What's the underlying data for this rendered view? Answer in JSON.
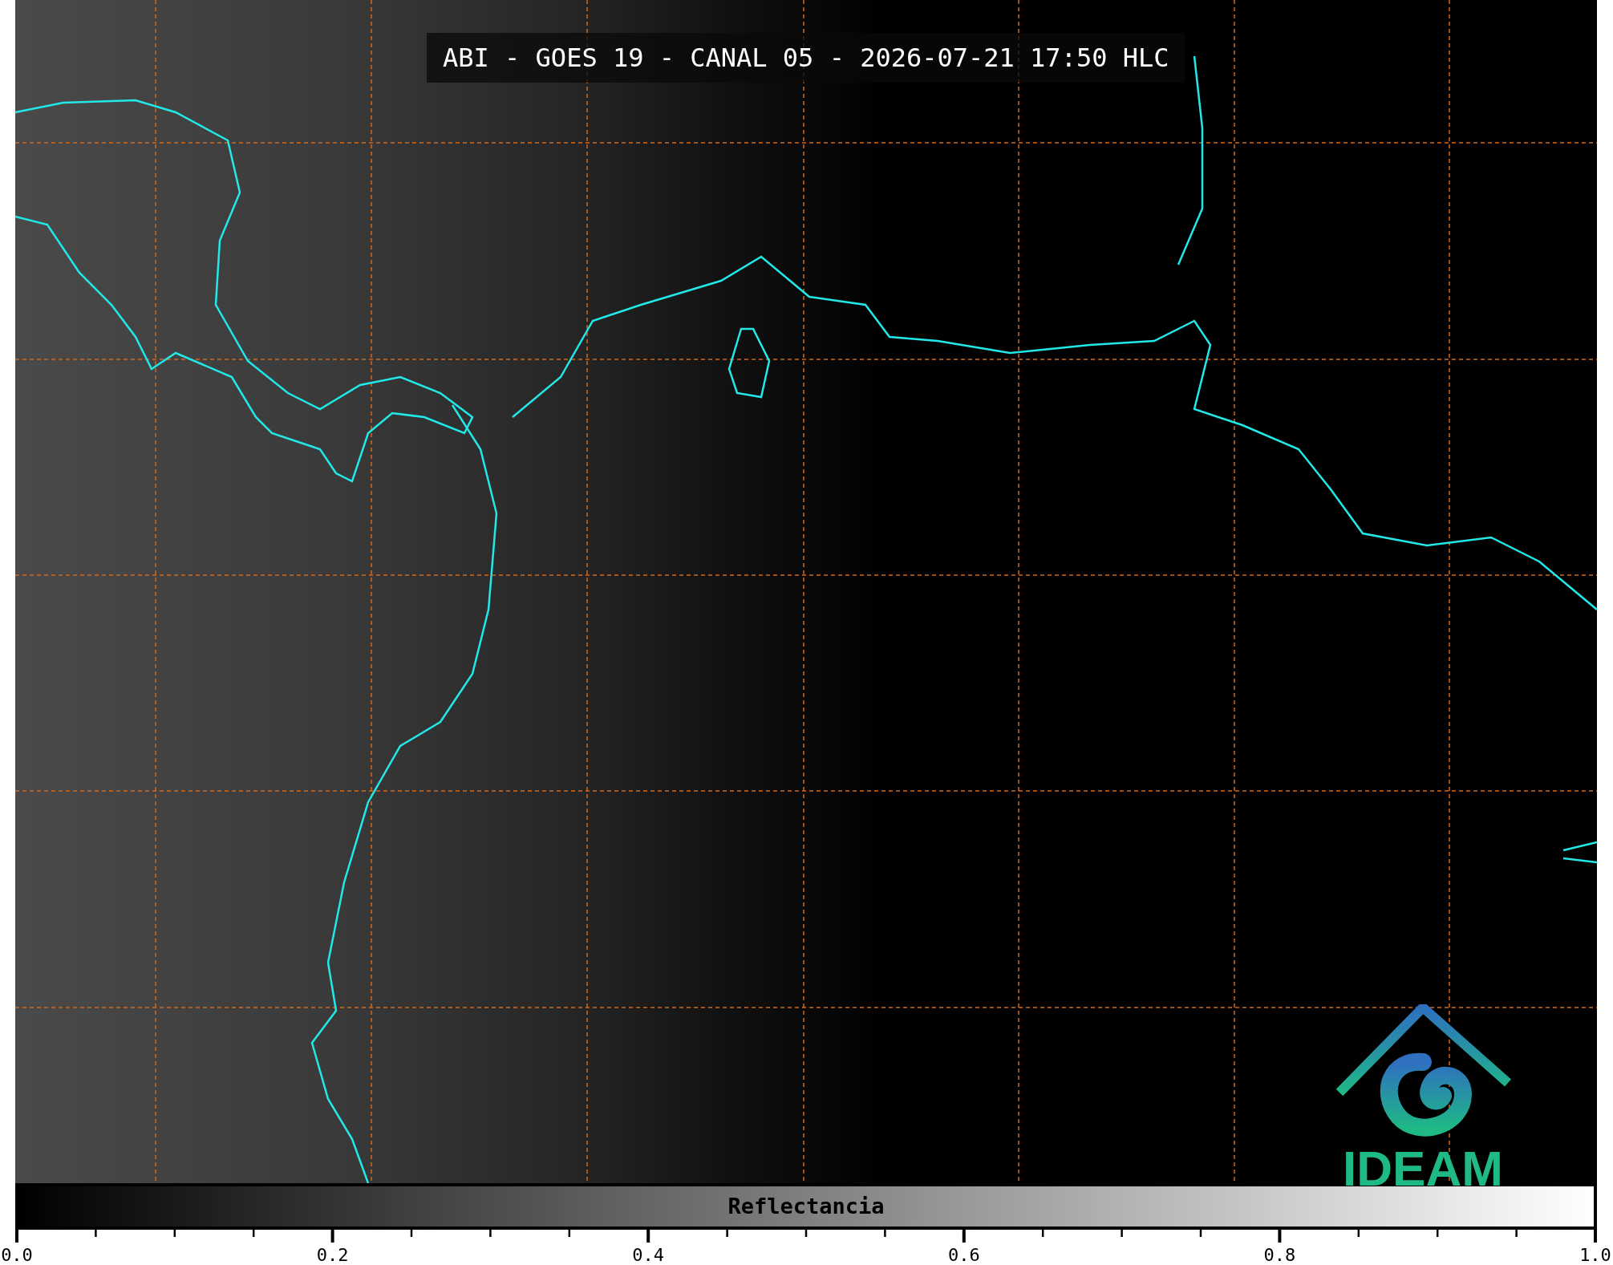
{
  "title": "ABI - GOES 19 - CANAL 05 - 2026-07-21 17:50 HLC",
  "logo": {
    "text": "IDEAM"
  },
  "colorbar": {
    "label": "Reflectancia",
    "ticks": [
      "0.0",
      "0.2",
      "0.4",
      "0.6",
      "0.8",
      "1.0"
    ]
  }
}
